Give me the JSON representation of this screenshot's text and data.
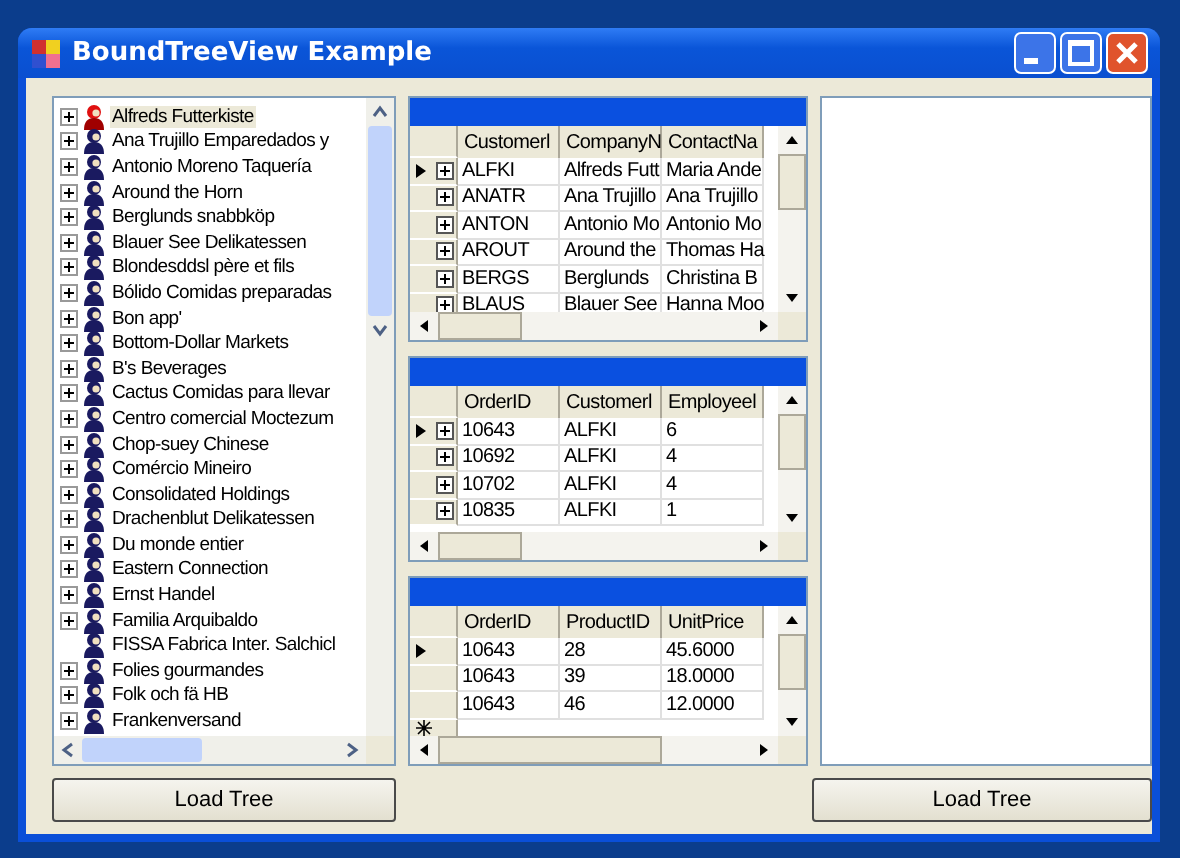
{
  "window": {
    "title": "BoundTreeView Example"
  },
  "tree": {
    "items": [
      {
        "label": "Alfreds Futterkiste",
        "expandable": true,
        "selected": true
      },
      {
        "label": "Ana Trujillo Emparedados y",
        "expandable": true,
        "selected": false
      },
      {
        "label": "Antonio Moreno Taquería",
        "expandable": true,
        "selected": false
      },
      {
        "label": "Around the Horn",
        "expandable": true,
        "selected": false
      },
      {
        "label": "Berglunds snabbköp",
        "expandable": true,
        "selected": false
      },
      {
        "label": "Blauer See Delikatessen",
        "expandable": true,
        "selected": false
      },
      {
        "label": "Blondesddsl père et fils",
        "expandable": true,
        "selected": false
      },
      {
        "label": "Bólido Comidas preparadas",
        "expandable": true,
        "selected": false
      },
      {
        "label": "Bon app'",
        "expandable": true,
        "selected": false
      },
      {
        "label": "Bottom-Dollar Markets",
        "expandable": true,
        "selected": false
      },
      {
        "label": "B's Beverages",
        "expandable": true,
        "selected": false
      },
      {
        "label": "Cactus Comidas para llevar",
        "expandable": true,
        "selected": false
      },
      {
        "label": "Centro comercial Moctezum",
        "expandable": true,
        "selected": false
      },
      {
        "label": "Chop-suey Chinese",
        "expandable": true,
        "selected": false
      },
      {
        "label": "Comércio Mineiro",
        "expandable": true,
        "selected": false
      },
      {
        "label": "Consolidated Holdings",
        "expandable": true,
        "selected": false
      },
      {
        "label": "Drachenblut Delikatessen",
        "expandable": true,
        "selected": false
      },
      {
        "label": "Du monde entier",
        "expandable": true,
        "selected": false
      },
      {
        "label": "Eastern Connection",
        "expandable": true,
        "selected": false
      },
      {
        "label": "Ernst Handel",
        "expandable": true,
        "selected": false
      },
      {
        "label": "Familia Arquibaldo",
        "expandable": true,
        "selected": false
      },
      {
        "label": "FISSA Fabrica Inter. Salchicl",
        "expandable": false,
        "selected": false
      },
      {
        "label": "Folies gourmandes",
        "expandable": true,
        "selected": false
      },
      {
        "label": "Folk och fä HB",
        "expandable": true,
        "selected": false
      },
      {
        "label": "Frankenversand",
        "expandable": true,
        "selected": false
      }
    ]
  },
  "grids": [
    {
      "columns": [
        "Customerl",
        "CompanyN",
        "ContactNa"
      ],
      "expandable": true,
      "new_row": false,
      "rows": [
        {
          "current": true,
          "cells": [
            "ALFKI",
            "Alfreds Futt",
            "Maria Ande"
          ]
        },
        {
          "current": false,
          "cells": [
            "ANATR",
            "Ana Trujillo",
            "Ana Trujillo"
          ]
        },
        {
          "current": false,
          "cells": [
            "ANTON",
            "Antonio Mo",
            "Antonio Mo"
          ]
        },
        {
          "current": false,
          "cells": [
            "AROUT",
            "Around the",
            "Thomas Ha"
          ]
        },
        {
          "current": false,
          "cells": [
            "BERGS",
            "Berglunds",
            "Christina B"
          ]
        },
        {
          "current": false,
          "cells": [
            "BLAUS",
            "Blauer See",
            "Hanna Moo"
          ]
        }
      ]
    },
    {
      "columns": [
        "OrderID",
        "Customerl",
        "Employeel"
      ],
      "expandable": true,
      "new_row": false,
      "rows": [
        {
          "current": true,
          "cells": [
            "10643",
            "ALFKI",
            "6"
          ]
        },
        {
          "current": false,
          "cells": [
            "10692",
            "ALFKI",
            "4"
          ]
        },
        {
          "current": false,
          "cells": [
            "10702",
            "ALFKI",
            "4"
          ]
        },
        {
          "current": false,
          "cells": [
            "10835",
            "ALFKI",
            "1"
          ]
        }
      ]
    },
    {
      "columns": [
        "OrderID",
        "ProductID",
        "UnitPrice"
      ],
      "expandable": false,
      "new_row": true,
      "rows": [
        {
          "current": true,
          "cells": [
            "10643",
            "28",
            "45.6000"
          ]
        },
        {
          "current": false,
          "cells": [
            "10643",
            "39",
            "18.0000"
          ]
        },
        {
          "current": false,
          "cells": [
            "10643",
            "46",
            "12.0000"
          ]
        }
      ]
    }
  ],
  "buttons": [
    "Load Tree",
    "Load Tree"
  ]
}
